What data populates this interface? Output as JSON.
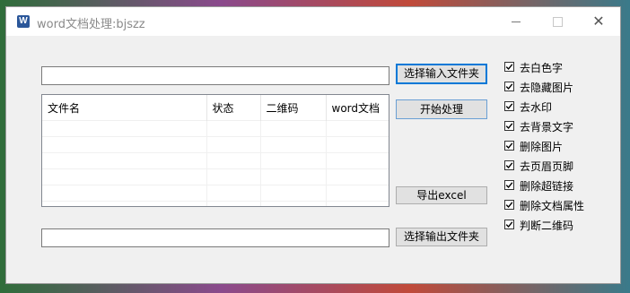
{
  "window": {
    "title": "word文档处理:bjszz",
    "app_icon": "word-icon",
    "controls": {
      "minimize": "minimize-icon",
      "maximize": "maximize-icon",
      "close": "✕"
    }
  },
  "input_folder": {
    "value": "",
    "button_label": "选择输入文件夹"
  },
  "start_button_label": "开始处理",
  "export_button_label": "导出excel",
  "output_folder": {
    "value": "",
    "button_label": "选择输出文件夹"
  },
  "table": {
    "columns": [
      "文件名",
      "状态",
      "二维码",
      "word文档"
    ],
    "rows": []
  },
  "options": [
    {
      "label": "去白色字",
      "checked": true
    },
    {
      "label": "去隐藏图片",
      "checked": true
    },
    {
      "label": "去水印",
      "checked": true
    },
    {
      "label": "去背景文字",
      "checked": true
    },
    {
      "label": "删除图片",
      "checked": true
    },
    {
      "label": "去页眉页脚",
      "checked": true
    },
    {
      "label": "删除超链接",
      "checked": true
    },
    {
      "label": "删除文档属性",
      "checked": true
    },
    {
      "label": "判断二维码",
      "checked": true
    }
  ],
  "colors": {
    "focus_border": "#0078d7",
    "window_bg": "#f0f0f0",
    "title_text": "#8a8a8a"
  }
}
